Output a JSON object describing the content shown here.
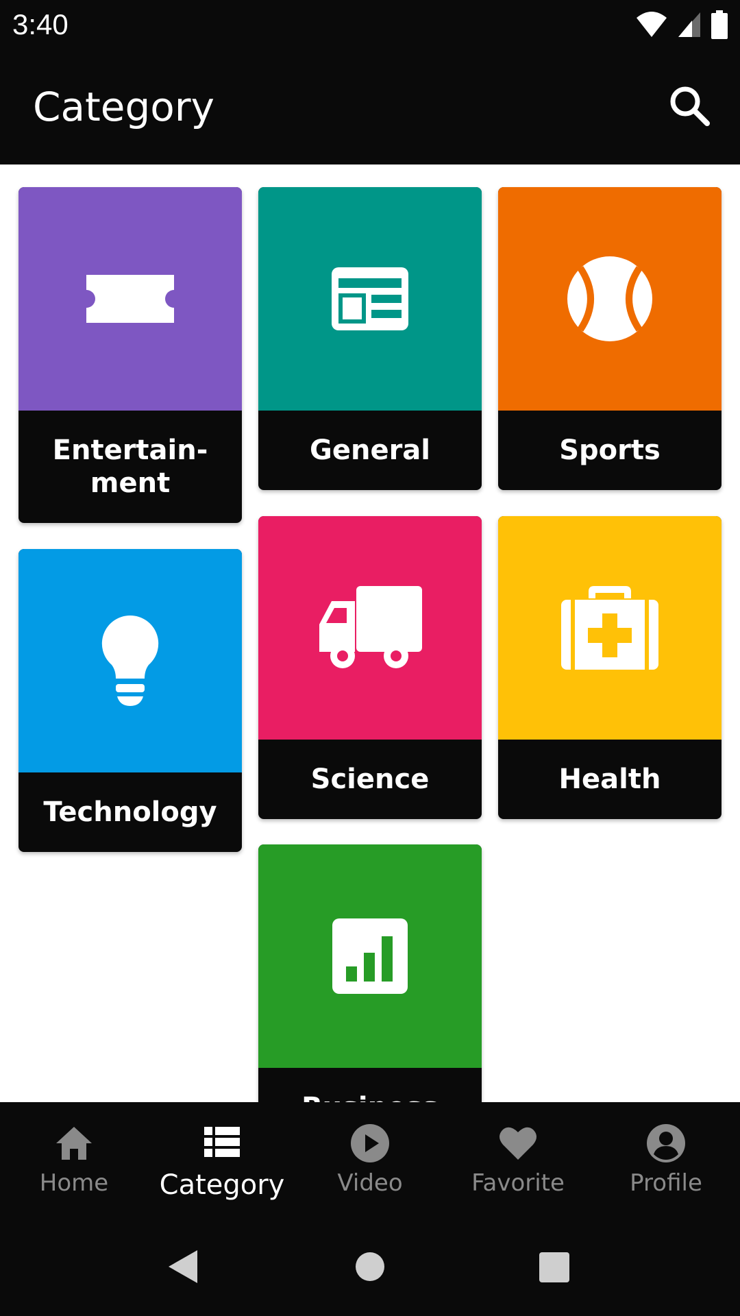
{
  "status": {
    "time": "3:40"
  },
  "header": {
    "title": "Category",
    "search_icon": "search-icon"
  },
  "categories": [
    {
      "label": "Entertain-ment",
      "color": "#7E57C2",
      "icon": "ticket-icon"
    },
    {
      "label": "General",
      "color": "#009688",
      "icon": "newspaper-icon"
    },
    {
      "label": "Sports",
      "color": "#EF6C00",
      "icon": "tennis-ball-icon"
    },
    {
      "label": "Technology",
      "color": "#039BE5",
      "icon": "lightbulb-icon"
    },
    {
      "label": "Science",
      "color": "#E91E63",
      "icon": "truck-icon"
    },
    {
      "label": "Health",
      "color": "#FFC107",
      "icon": "medical-kit-icon"
    },
    {
      "label": "Business",
      "color": "#279C26",
      "icon": "bar-chart-icon"
    }
  ],
  "nav": {
    "items": [
      {
        "label": "Home",
        "icon": "home-icon",
        "active": false
      },
      {
        "label": "Category",
        "icon": "list-icon",
        "active": true
      },
      {
        "label": "Video",
        "icon": "play-circle-icon",
        "active": false
      },
      {
        "label": "Favorite",
        "icon": "heart-icon",
        "active": false
      },
      {
        "label": "Profile",
        "icon": "account-circle-icon",
        "active": false
      }
    ]
  }
}
